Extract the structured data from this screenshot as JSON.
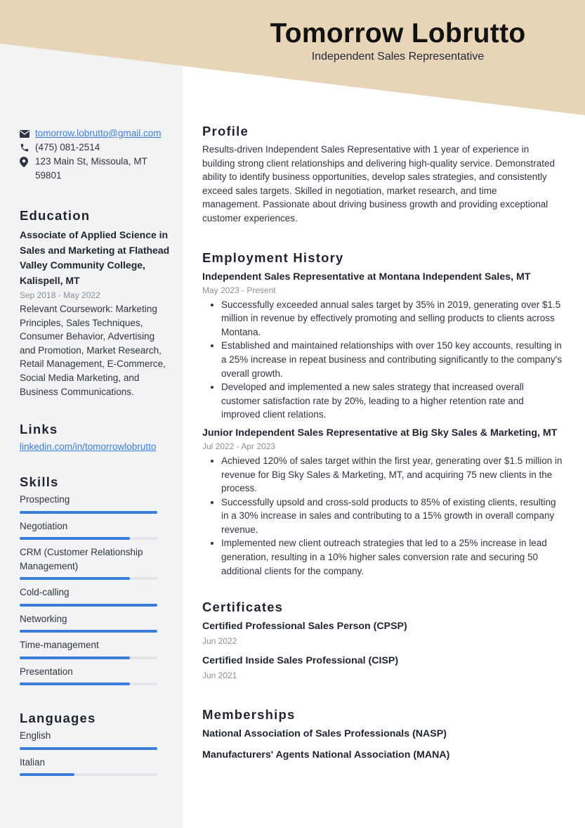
{
  "header": {
    "name": "Tomorrow Lobrutto",
    "role": "Independent Sales Representative",
    "accent_color": "#e8d5b7"
  },
  "contact": {
    "email": "tomorrow.lobrutto@gmail.com",
    "phone": "(475) 081-2514",
    "address_line1": "123 Main St, Missoula, MT",
    "address_line2": "59801",
    "icons": [
      "envelope-icon",
      "phone-icon",
      "map-pin-icon"
    ]
  },
  "education": {
    "title": "Education",
    "degree": "Associate of Applied Science in Sales and Marketing at Flathead Valley Community College, Kalispell, MT",
    "dates": "Sep 2018 - May 2022",
    "description": "Relevant Coursework: Marketing Principles, Sales Techniques, Consumer Behavior, Advertising and Promotion, Market Research, Retail Management, E-Commerce, Social Media Marketing, and Business Communications."
  },
  "links": {
    "title": "Links",
    "items": [
      {
        "label": "linkedin.com/in/tomorrowlobrutto"
      }
    ]
  },
  "skills": {
    "title": "Skills",
    "bar_color": "#3b7ddd",
    "items": [
      {
        "label": "Prospecting",
        "level": 1.0
      },
      {
        "label": "Negotiation",
        "level": 0.8
      },
      {
        "label": "CRM (Customer Relationship Management)",
        "level": 0.8
      },
      {
        "label": "Cold-calling",
        "level": 1.0
      },
      {
        "label": "Networking",
        "level": 1.0
      },
      {
        "label": "Time-management",
        "level": 0.8
      },
      {
        "label": "Presentation",
        "level": 0.8
      }
    ]
  },
  "languages": {
    "title": "Languages",
    "items": [
      {
        "label": "English",
        "level": 1.0
      },
      {
        "label": "Italian",
        "level": 0.4
      }
    ]
  },
  "profile": {
    "title": "Profile",
    "text": "Results-driven Independent Sales Representative with 1 year of experience in building strong client relationships and delivering high-quality service. Demonstrated ability to identify business opportunities, develop sales strategies, and consistently exceed sales targets. Skilled in negotiation, market research, and time management. Passionate about driving business growth and providing exceptional customer experiences."
  },
  "employment": {
    "title": "Employment History",
    "jobs": [
      {
        "title": "Independent Sales Representative at Montana Independent Sales, MT",
        "dates": "May 2023 - Present",
        "bullets": [
          "Successfully exceeded annual sales target by 35% in 2019, generating over $1.5 million in revenue by effectively promoting and selling products to clients across Montana.",
          "Established and maintained relationships with over 150 key accounts, resulting in a 25% increase in repeat business and contributing significantly to the company's overall growth.",
          "Developed and implemented a new sales strategy that increased overall customer satisfaction rate by 20%, leading to a higher retention rate and improved client relations."
        ]
      },
      {
        "title": "Junior Independent Sales Representative at Big Sky Sales & Marketing, MT",
        "dates": "Jul 2022 - Apr 2023",
        "bullets": [
          "Achieved 120% of sales target within the first year, generating over $1.5 million in revenue for Big Sky Sales & Marketing, MT, and acquiring 75 new clients in the process.",
          "Successfully upsold and cross-sold products to 85% of existing clients, resulting in a 30% increase in sales and contributing to a 15% growth in overall company revenue.",
          "Implemented new client outreach strategies that led to a 25% increase in lead generation, resulting in a 10% higher sales conversion rate and securing 50 additional clients for the company."
        ]
      }
    ]
  },
  "certificates": {
    "title": "Certificates",
    "items": [
      {
        "name": "Certified Professional Sales Person (CPSP)",
        "date": "Jun 2022"
      },
      {
        "name": "Certified Inside Sales Professional (CISP)",
        "date": "Jun 2021"
      }
    ]
  },
  "memberships": {
    "title": "Memberships",
    "items": [
      {
        "name": "National Association of Sales Professionals (NASP)"
      },
      {
        "name": "Manufacturers' Agents National Association (MANA)"
      }
    ]
  }
}
